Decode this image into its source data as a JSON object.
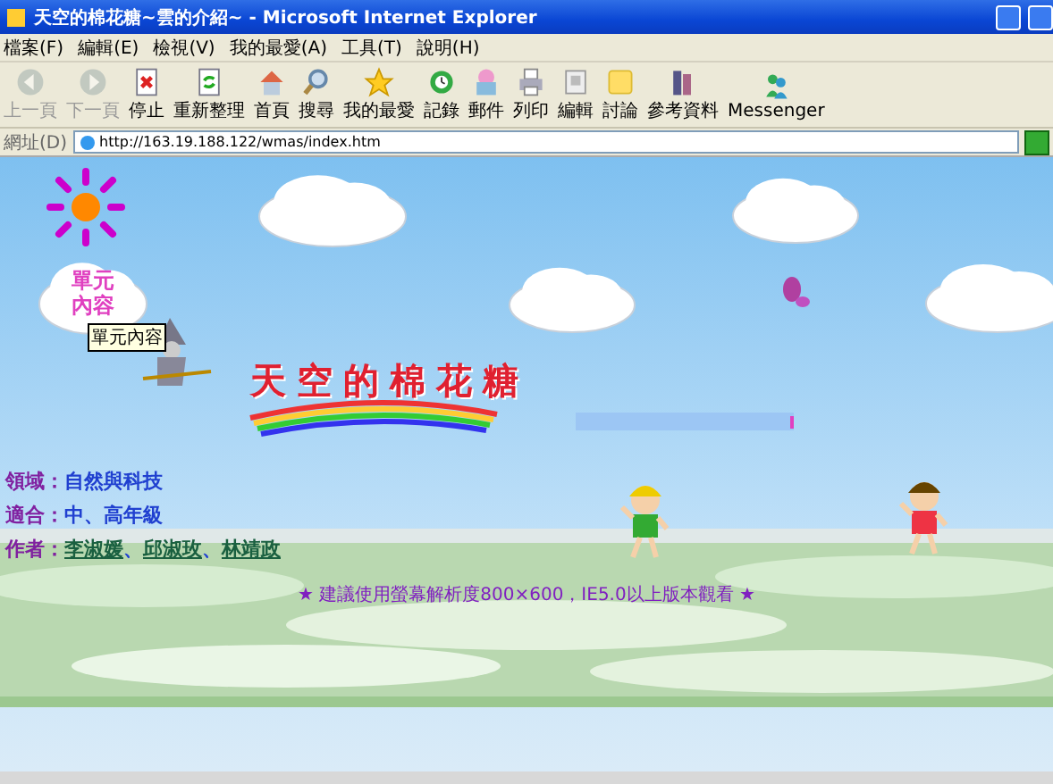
{
  "window": {
    "title": "天空的棉花糖~雲的介紹~ - Microsoft Internet Explorer"
  },
  "menu": [
    "檔案(F)",
    "編輯(E)",
    "檢視(V)",
    "我的最愛(A)",
    "工具(T)",
    "說明(H)"
  ],
  "toolbar": [
    {
      "kind": "back",
      "label": "上一頁",
      "disabled": true
    },
    {
      "kind": "forward",
      "label": "下一頁",
      "disabled": true
    },
    {
      "kind": "stop",
      "label": "停止",
      "disabled": false
    },
    {
      "kind": "refresh",
      "label": "重新整理",
      "disabled": false
    },
    {
      "kind": "home",
      "label": "首頁",
      "disabled": false
    },
    {
      "kind": "search",
      "label": "搜尋",
      "disabled": false
    },
    {
      "kind": "favorites",
      "label": "我的最愛",
      "disabled": false
    },
    {
      "kind": "history",
      "label": "記錄",
      "disabled": false
    },
    {
      "kind": "mail",
      "label": "郵件",
      "disabled": false
    },
    {
      "kind": "print",
      "label": "列印",
      "disabled": false
    },
    {
      "kind": "edit",
      "label": "編輯",
      "disabled": false
    },
    {
      "kind": "discuss",
      "label": "討論",
      "disabled": false
    },
    {
      "kind": "research",
      "label": "參考資料",
      "disabled": false
    },
    {
      "kind": "messenger",
      "label": "Messenger",
      "disabled": false
    }
  ],
  "address": {
    "label": "網址(D)",
    "value": "http://163.19.188.122/wmas/index.htm"
  },
  "page": {
    "unit_button": "單元內容",
    "tooltip": "單元內容",
    "site_title": "天空的棉花糖",
    "info": [
      {
        "label": "領域：",
        "value": "自然與科技"
      },
      {
        "label": "適合：",
        "value": "中、高年級"
      }
    ],
    "authors": {
      "label": "作者：",
      "separator": "、",
      "names": [
        "李淑媛",
        "邱淑玫",
        "林靖政"
      ]
    },
    "notice": "★ 建議使用螢幕解析度800×600，IE5.0以上版本觀看 ★"
  }
}
